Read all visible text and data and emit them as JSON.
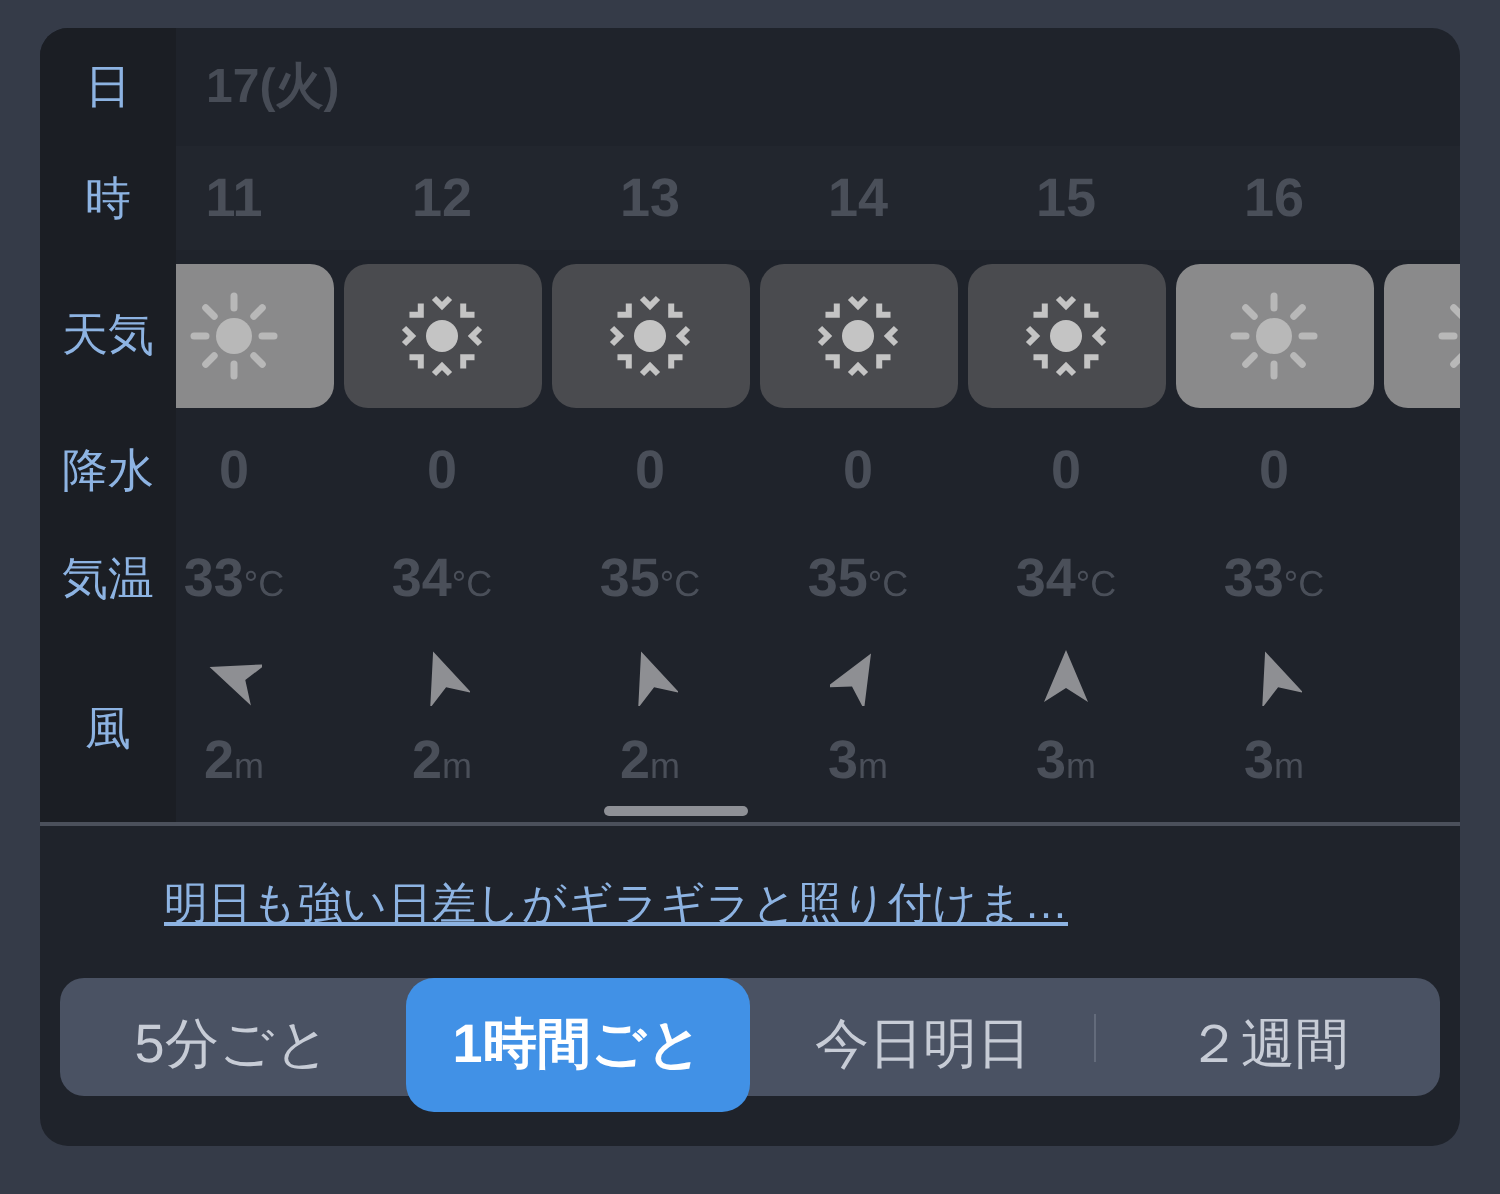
{
  "row_labels": {
    "date": "日",
    "hour": "時",
    "weather": "天気",
    "precip": "降水",
    "temp": "気温",
    "wind": "風"
  },
  "date": "17(火)",
  "hours": [
    {
      "hour": "11",
      "weather": {
        "kind": "sunny"
      },
      "precip": "0",
      "temp": "33",
      "temp_unit": "°C",
      "wind_arrow": {
        "kind": "wnw"
      },
      "wind": "2",
      "wind_unit": "m"
    },
    {
      "hour": "12",
      "weather": {
        "kind": "hot"
      },
      "precip": "0",
      "temp": "34",
      "temp_unit": "°C",
      "wind_arrow": {
        "kind": "nnw"
      },
      "wind": "2",
      "wind_unit": "m"
    },
    {
      "hour": "13",
      "weather": {
        "kind": "hot"
      },
      "precip": "0",
      "temp": "35",
      "temp_unit": "°C",
      "wind_arrow": {
        "kind": "nnw"
      },
      "wind": "2",
      "wind_unit": "m"
    },
    {
      "hour": "14",
      "weather": {
        "kind": "hot"
      },
      "precip": "0",
      "temp": "35",
      "temp_unit": "°C",
      "wind_arrow": {
        "kind": "nne"
      },
      "wind": "3",
      "wind_unit": "m"
    },
    {
      "hour": "15",
      "weather": {
        "kind": "hot"
      },
      "precip": "0",
      "temp": "34",
      "temp_unit": "°C",
      "wind_arrow": {
        "kind": "n"
      },
      "wind": "3",
      "wind_unit": "m"
    },
    {
      "hour": "16",
      "weather": {
        "kind": "sunny"
      },
      "precip": "0",
      "temp": "33",
      "temp_unit": "°C",
      "wind_arrow": {
        "kind": "nnw"
      },
      "wind": "3",
      "wind_unit": "m"
    },
    {
      "weather": {
        "kind": "sunny"
      }
    }
  ],
  "forecast_link": "明日も強い日差しがギラギラと照り付けま…",
  "modes": [
    {
      "label": "5分ごと",
      "selected": false
    },
    {
      "label": "1時間ごと",
      "selected": true
    },
    {
      "label": "今日明日",
      "selected": false
    },
    {
      "label": "２週間",
      "selected": false
    }
  ]
}
